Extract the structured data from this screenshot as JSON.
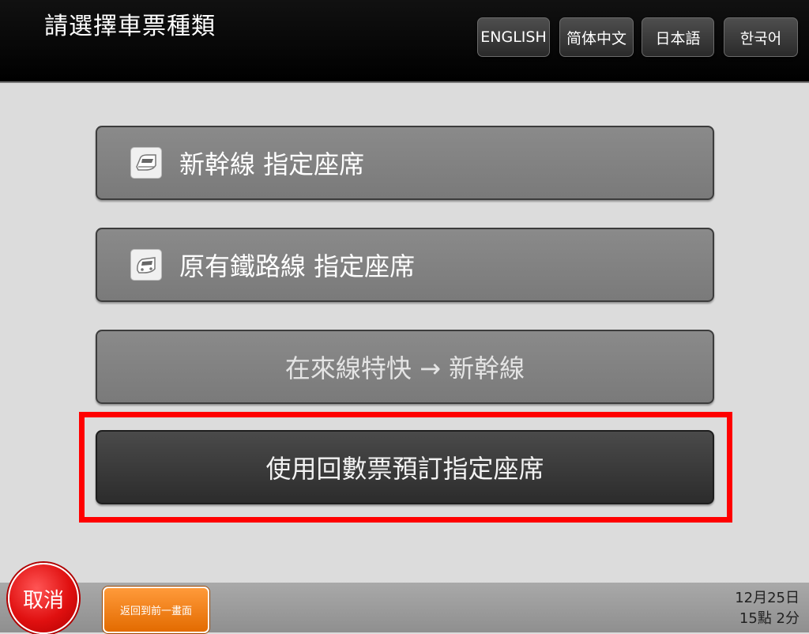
{
  "header": {
    "title": "請選擇車票種類",
    "languages": [
      "ENGLISH",
      "简体中文",
      "日本語",
      "한국어"
    ]
  },
  "menu": {
    "items": [
      {
        "label": "新幹線  指定座席",
        "icon": "shinkansen-train-icon"
      },
      {
        "label": "原有鐵路線    指定座席",
        "icon": "conventional-train-icon"
      },
      {
        "label": "在來線特快 → 新幹線"
      },
      {
        "label": "使用回數票預訂指定座席",
        "highlighted": true
      }
    ]
  },
  "footer": {
    "cancel_label": "取消",
    "back_label": "返回到前一畫面",
    "date": "12月25日",
    "time": "15點 2分"
  },
  "colors": {
    "highlight": "#ff0000",
    "cancel": "#e01010",
    "back": "#f07a10"
  }
}
